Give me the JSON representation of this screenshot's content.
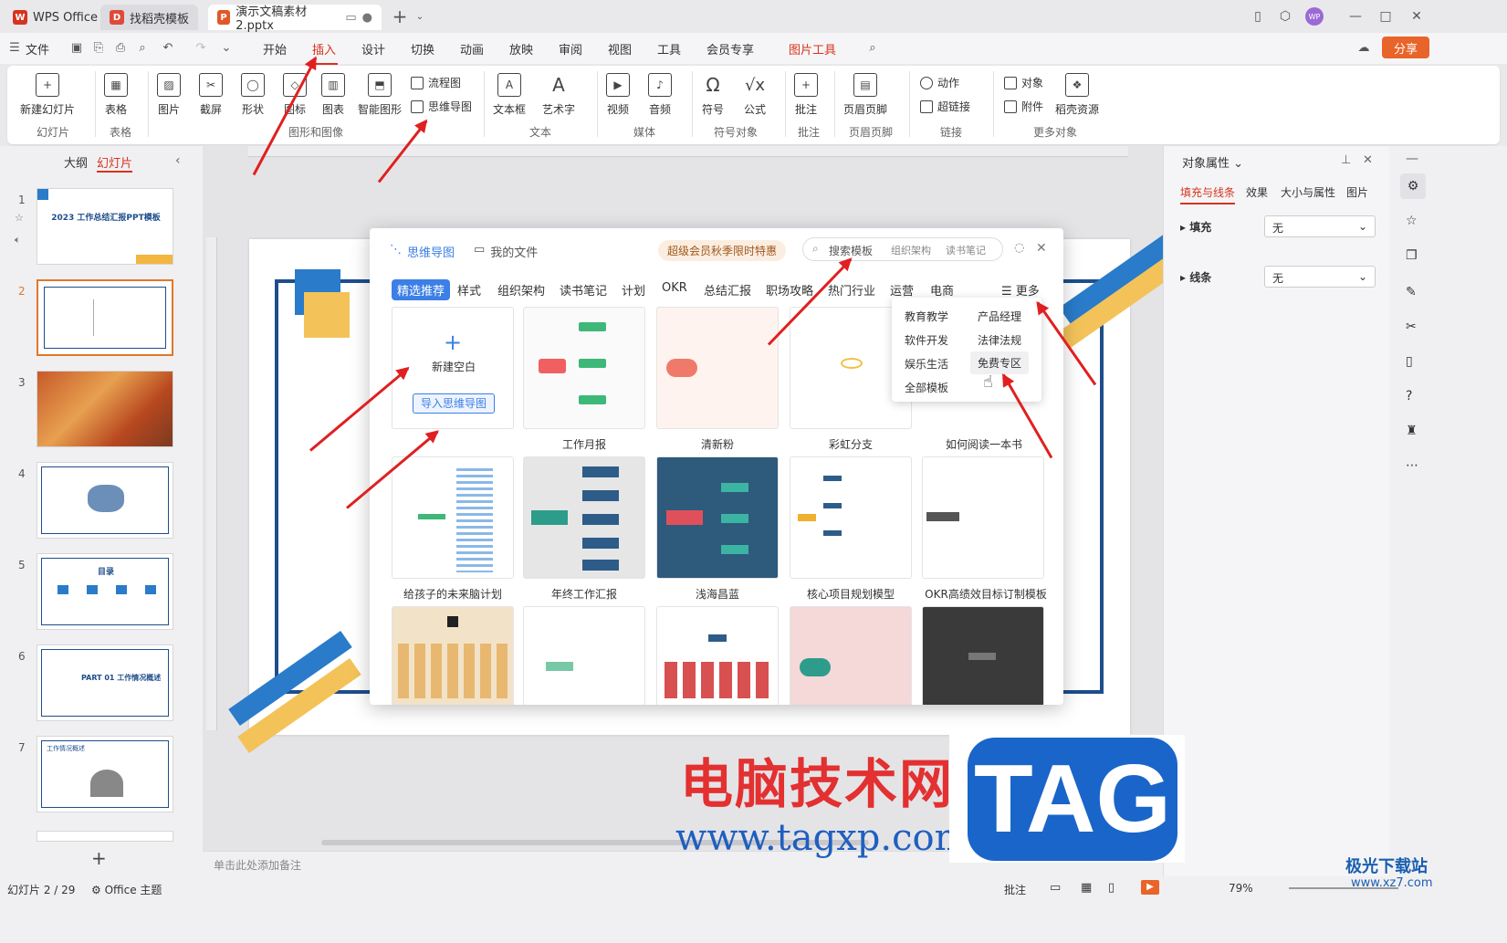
{
  "titlebar": {
    "tabs": [
      {
        "label": "WPS Office"
      },
      {
        "label": "找稻壳模板"
      },
      {
        "label": "演示文稿素材2.pptx"
      }
    ],
    "avatar": "WP"
  },
  "menubar": {
    "file": "文件",
    "items": [
      "开始",
      "插入",
      "设计",
      "切换",
      "动画",
      "放映",
      "审阅",
      "视图",
      "工具",
      "会员专享",
      "图片工具"
    ],
    "active": "插入",
    "share": "分享"
  },
  "ribbon": {
    "new_slide": "新建幻灯片",
    "table": "表格",
    "picture": "图片",
    "screenshot": "截屏",
    "shape": "形状",
    "icon": "图标",
    "chart": "图表",
    "smart_graphic": "智能图形",
    "flowchart": "流程图",
    "mindmap": "思维导图",
    "textbox": "文本框",
    "wordart": "艺术字",
    "video": "视频",
    "audio": "音频",
    "symbol": "符号",
    "formula": "公式",
    "comment": "批注",
    "header_footer": "页眉页脚",
    "action": "动作",
    "hyperlink": "超链接",
    "object": "对象",
    "attachment": "附件",
    "docer_resource": "稻壳资源",
    "groups": [
      "幻灯片",
      "表格",
      "图形和图像",
      "文本",
      "媒体",
      "符号对象",
      "批注",
      "页眉页脚",
      "链接",
      "更多对象"
    ]
  },
  "leftpanel": {
    "tabs": [
      "大纲",
      "幻灯片"
    ],
    "active": "幻灯片",
    "slides": [
      {
        "num": "1",
        "text": "2023 工作总结汇报PPT模板"
      },
      {
        "num": "2",
        "text": ""
      },
      {
        "num": "3",
        "text": ""
      },
      {
        "num": "4",
        "text": ""
      },
      {
        "num": "5",
        "text": "目录"
      },
      {
        "num": "6",
        "text": "PART 01 工作情况概述"
      },
      {
        "num": "7",
        "text": "工作情况概述"
      }
    ]
  },
  "dialog": {
    "title": "思维导图",
    "my_files": "我的文件",
    "promo": "超级会员秋季限时特惠",
    "search_placeholder": "搜索模板",
    "search_tags": [
      "组织架构",
      "读书笔记"
    ],
    "categories": [
      "精选推荐",
      "样式",
      "组织架构",
      "读书笔记",
      "计划",
      "OKR",
      "总结汇报",
      "职场攻略",
      "热门行业",
      "运营",
      "电商"
    ],
    "more": "更多",
    "new_blank": "新建空白",
    "import": "导入思维导图",
    "templates_row1": [
      "工作月报",
      "清新粉",
      "彩虹分支",
      "如何阅读一本书"
    ],
    "templates_row2": [
      "给孩子的未来脑计划",
      "年终工作汇报",
      "浅海昌蓝",
      "核心项目规划模型",
      "OKR高绩效目标订制模板"
    ],
    "dropdown": [
      "教育教学",
      "产品经理",
      "软件开发",
      "法律法规",
      "娱乐生活",
      "免费专区",
      "全部模板"
    ]
  },
  "rightpanel": {
    "title": "对象属性",
    "tabs": [
      "填充与线条",
      "效果",
      "大小与属性",
      "图片"
    ],
    "fill_label": "填充",
    "fill_value": "无",
    "line_label": "线条",
    "line_value": "无"
  },
  "statusbar": {
    "slide_info": "幻灯片 2 / 29",
    "theme": "Office 主题",
    "notes_placeholder": "单击此处添加备注",
    "comment": "批注",
    "zoom": "79%"
  },
  "watermark": {
    "site_name": "电脑技术网",
    "url": "www.tagxp.com",
    "tag": "TAG",
    "corner": "极光下载站",
    "corner_url": "www.xz7.com"
  }
}
